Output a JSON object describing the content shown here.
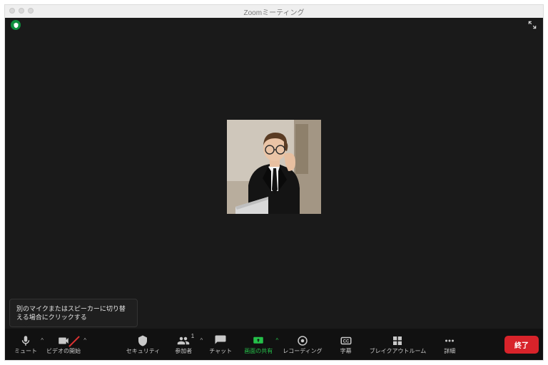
{
  "window": {
    "title": "Zoomミーティング"
  },
  "tooltip": {
    "text": "別のマイクまたはスピーカーに切り替える場合にクリックする"
  },
  "toolbar": {
    "mute": "ミュート",
    "video": "ビデオの開始",
    "security": "セキュリティ",
    "participants": "参加者",
    "participants_count": "1",
    "chat": "チャット",
    "share": "画面の共有",
    "record": "レコーディング",
    "cc": "字幕",
    "breakout": "ブレイクアウトルーム",
    "more": "詳細",
    "end": "終了"
  }
}
